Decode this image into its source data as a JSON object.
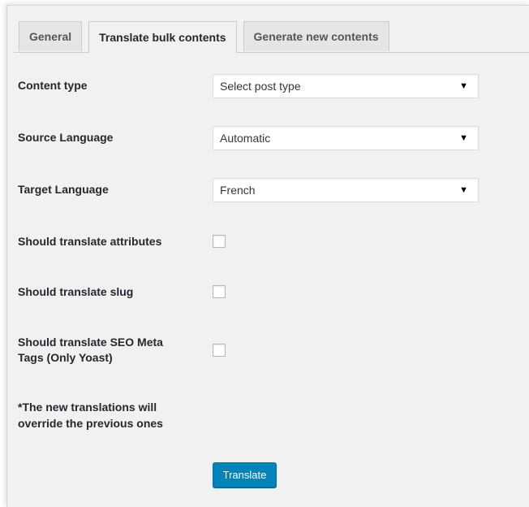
{
  "tabs": [
    {
      "label": "General",
      "active": false
    },
    {
      "label": "Translate bulk contents",
      "active": true
    },
    {
      "label": "Generate new contents",
      "active": false
    }
  ],
  "form": {
    "content_type": {
      "label": "Content type",
      "value": "Select post type"
    },
    "source_language": {
      "label": "Source Language",
      "value": "Automatic"
    },
    "target_language": {
      "label": "Target Language",
      "value": "French"
    },
    "translate_attributes": {
      "label": "Should translate attributes",
      "checked": false
    },
    "translate_slug": {
      "label": "Should translate slug",
      "checked": false
    },
    "translate_seo": {
      "label_line1": "Should translate SEO Meta",
      "label_line2": "Tags (Only Yoast)",
      "checked": false
    }
  },
  "note": {
    "line1": "*The new translations will",
    "line2": "override the previous ones"
  },
  "submit_label": "Translate",
  "dropdown_arrow": "▼",
  "colors": {
    "primary_button": "#0085ba",
    "background": "#f1f1f1"
  }
}
